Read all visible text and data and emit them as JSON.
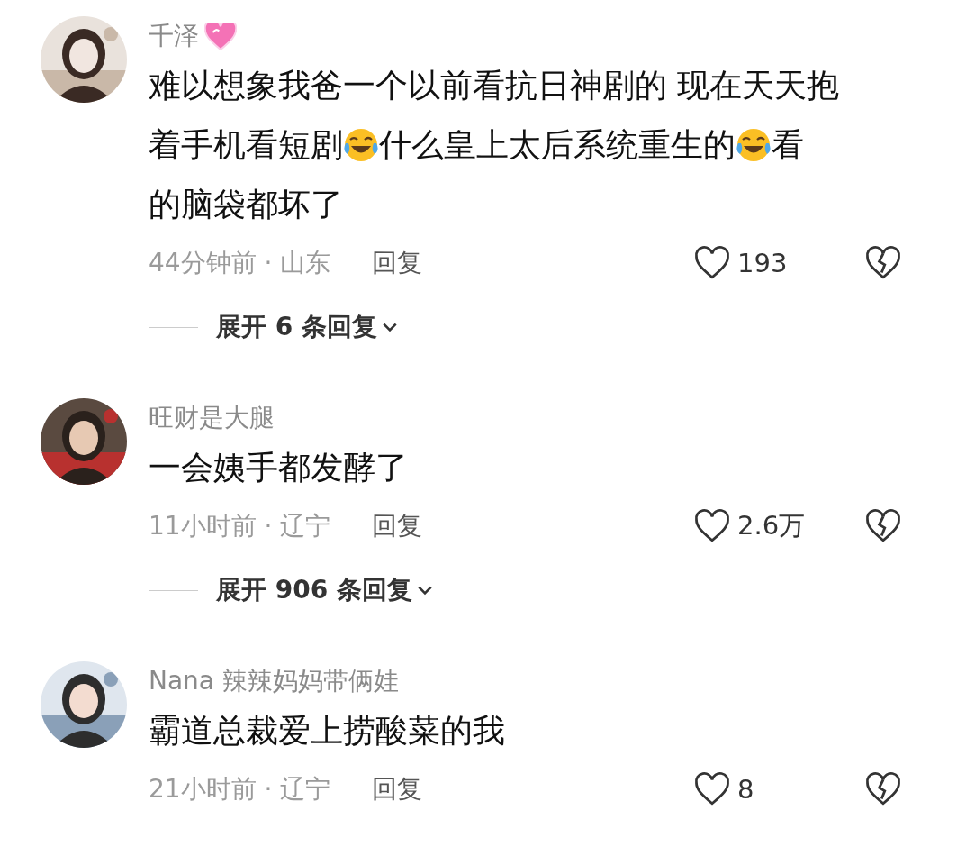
{
  "comments": [
    {
      "user": "千泽",
      "heart_badge": true,
      "lines": [
        [
          {
            "kind": "text",
            "text": "难以想象我爸一个以前看抗日神剧的 现在天天抱"
          }
        ],
        [
          {
            "kind": "text",
            "text": "着手机看短剧"
          },
          {
            "kind": "emoji"
          },
          {
            "kind": "text",
            "text": "什么皇上太后系统重生的"
          },
          {
            "kind": "emoji"
          },
          {
            "kind": "text",
            "text": "看"
          }
        ],
        [
          {
            "kind": "text",
            "text": "的脑袋都坏了"
          }
        ]
      ],
      "time": "44分钟前 · 山东",
      "reply": "回复",
      "likes": "193",
      "expand": "展开 6 条回复"
    },
    {
      "user": "旺财是大腿",
      "heart_badge": false,
      "lines": [
        [
          {
            "kind": "text",
            "text": "一会姨手都发酵了"
          }
        ]
      ],
      "time": "11小时前 · 辽宁",
      "reply": "回复",
      "likes": "2.6万",
      "expand": "展开 906 条回复"
    },
    {
      "user": "Nana 辣辣妈妈带俩娃",
      "heart_badge": false,
      "lines": [
        [
          {
            "kind": "text",
            "text": "霸道总裁爱上捞酸菜的我"
          }
        ]
      ],
      "time": "21小时前 · 辽宁",
      "reply": "回复",
      "likes": "8"
    }
  ]
}
